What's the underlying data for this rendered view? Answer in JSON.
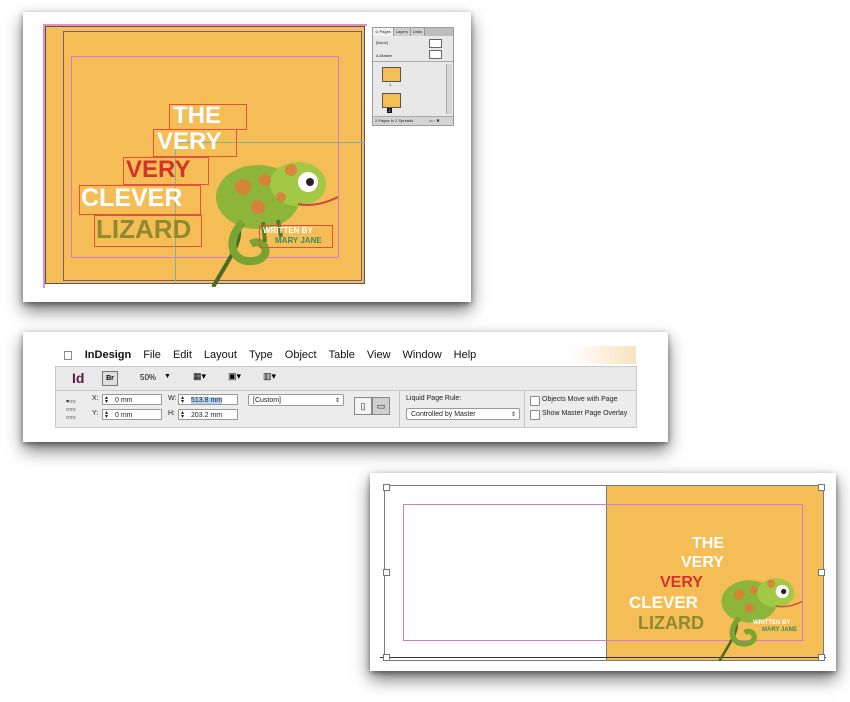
{
  "colors": {
    "page": "#F4BD55",
    "word_white": "#FFFFFF",
    "word_red": "#D5332A",
    "word_olive": "#8F8A2E",
    "byline": "#3D8C56",
    "frame": "#E0533A",
    "guide": "#D57AD0"
  },
  "cover": {
    "line1": "THE",
    "line2": "VERY",
    "line3": "VERY",
    "line4": "CLEVER",
    "line5": "LIZARD",
    "byline1": "WRITTEN BY",
    "byline2": "MARY JANE"
  },
  "pages_panel": {
    "tabs": [
      "≎ Pages",
      "Layers",
      "Links"
    ],
    "none_label": "[None]",
    "master_label": "A-Master",
    "page1": "1",
    "page2": "2",
    "footer": "2 Pages in 2 Spreads"
  },
  "menubar": {
    "app": "InDesign",
    "items": [
      "File",
      "Edit",
      "Layout",
      "Type",
      "Object",
      "Table",
      "View",
      "Window",
      "Help"
    ]
  },
  "toolbar": {
    "logo": "Id",
    "bridge": "Br",
    "zoom": "50%"
  },
  "control": {
    "x_label": "X:",
    "x_value": "0 mm",
    "y_label": "Y:",
    "y_value": "0 mm",
    "w_label": "W:",
    "w_value": "513.8 mm",
    "h_label": "H:",
    "h_value": "203.2 mm",
    "preset": "[Custom]",
    "liquid_label": "Liquid Page Rule:",
    "liquid_value": "Controlled by Master",
    "objects_move": "Objects Move with Page",
    "show_master": "Show Master Page Overlay"
  }
}
